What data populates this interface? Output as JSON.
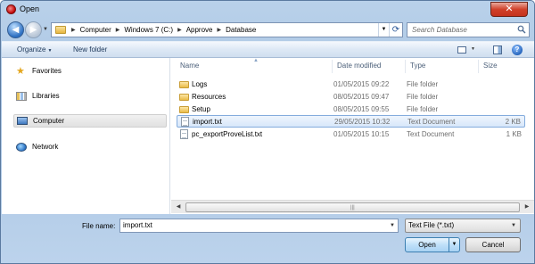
{
  "window": {
    "title": "Open",
    "close_glyph": "✕"
  },
  "nav": {
    "back_glyph": "◀",
    "forward_glyph": "▶"
  },
  "address": {
    "crumbs": [
      "Computer",
      "Windows 7 (C:)",
      "Approve",
      "Database"
    ],
    "refresh_glyph": "⟳"
  },
  "search": {
    "placeholder": "Search Database",
    "icon": "search-icon"
  },
  "toolbar": {
    "organize": "Organize",
    "new_folder": "New folder",
    "help": "?"
  },
  "sidebar": {
    "items": [
      {
        "label": "Favorites",
        "icon": "star-icon"
      },
      {
        "label": "Libraries",
        "icon": "libraries-icon"
      },
      {
        "label": "Computer",
        "icon": "computer-icon",
        "selected": true
      },
      {
        "label": "Network",
        "icon": "network-icon"
      }
    ]
  },
  "columns": {
    "name": "Name",
    "date": "Date modified",
    "type": "Type",
    "size": "Size"
  },
  "files": [
    {
      "name": "Logs",
      "date": "01/05/2015 09:22",
      "type": "File folder",
      "size": "",
      "icon": "folder-icon"
    },
    {
      "name": "Resources",
      "date": "08/05/2015 09:47",
      "type": "File folder",
      "size": "",
      "icon": "folder-icon"
    },
    {
      "name": "Setup",
      "date": "08/05/2015 09:55",
      "type": "File folder",
      "size": "",
      "icon": "folder-icon"
    },
    {
      "name": "import.txt",
      "date": "29/05/2015 10:32",
      "type": "Text Document",
      "size": "2 KB",
      "icon": "text-file-icon",
      "selected": true
    },
    {
      "name": "pc_exportProveList.txt",
      "date": "01/05/2015 10:15",
      "type": "Text Document",
      "size": "1 KB",
      "icon": "text-file-icon"
    }
  ],
  "bottom": {
    "file_name_label": "File name:",
    "file_name_value": "import.txt",
    "file_type_value": "Text File (*.txt)",
    "open_label": "Open",
    "cancel_label": "Cancel"
  },
  "colors": {
    "accent": "#3c7fb1",
    "selection": "#d8e7fa",
    "chrome": "#b9d1ea",
    "close": "#c5321d"
  }
}
